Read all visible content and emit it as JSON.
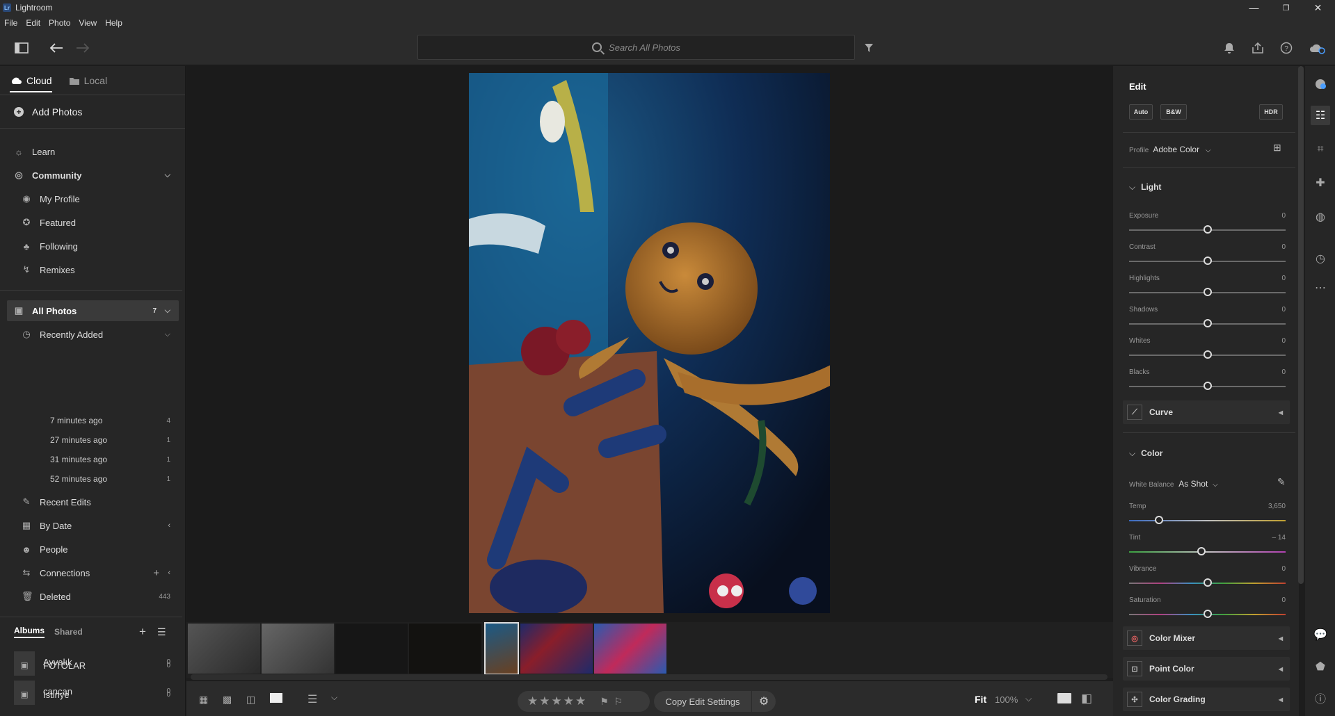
{
  "app": {
    "title": "Lightroom",
    "logo": "Lr"
  },
  "window": {
    "minimize": "—",
    "restore": "❐",
    "close": "✕"
  },
  "menu": [
    "File",
    "Edit",
    "Photo",
    "View",
    "Help"
  ],
  "search": {
    "placeholder": "Search All Photos"
  },
  "left": {
    "tabs": [
      "Cloud",
      "Local"
    ],
    "add_photos": "Add Photos",
    "learn": "Learn",
    "community": "Community",
    "community_items": [
      "My Profile",
      "Featured",
      "Following",
      "Remixes"
    ],
    "all_photos": {
      "label": "All Photos",
      "count": "7"
    },
    "recently_added": "Recently Added",
    "recent_groups": [
      {
        "label": "7 minutes ago",
        "count": "4"
      },
      {
        "label": "27 minutes ago",
        "count": "1"
      },
      {
        "label": "31 minutes ago",
        "count": "1"
      },
      {
        "label": "52 minutes ago",
        "count": "1"
      }
    ],
    "recent_edits": "Recent Edits",
    "by_date": "By Date",
    "people": "People",
    "connections": "Connections",
    "deleted": {
      "label": "Deleted",
      "count": "443"
    },
    "album_tabs": [
      "Albums",
      "Shared"
    ],
    "albums": [
      {
        "name": "Ayvalık",
        "count": "0"
      },
      {
        "name": "cancan",
        "count": "0"
      },
      {
        "name": "FOTOLAR",
        "count": "0"
      },
      {
        "name": "İstinye",
        "count": "0"
      }
    ]
  },
  "bottom": {
    "copy_edit": "Copy Edit Settings",
    "fit": "Fit",
    "zoom": "100%"
  },
  "edit": {
    "title": "Edit",
    "auto": "Auto",
    "bw": "B&W",
    "hdr": "HDR",
    "profile_label": "Profile",
    "profile_value": "Adobe Color",
    "light_title": "Light",
    "light": [
      {
        "label": "Exposure",
        "value": "0",
        "pos": 0.5
      },
      {
        "label": "Contrast",
        "value": "0",
        "pos": 0.5
      },
      {
        "label": "Highlights",
        "value": "0",
        "pos": 0.5
      },
      {
        "label": "Shadows",
        "value": "0",
        "pos": 0.5
      },
      {
        "label": "Whites",
        "value": "0",
        "pos": 0.5
      },
      {
        "label": "Blacks",
        "value": "0",
        "pos": 0.5
      }
    ],
    "curve": "Curve",
    "color_title": "Color",
    "wb_label": "White Balance",
    "wb_value": "As Shot",
    "color": [
      {
        "label": "Temp",
        "value": "3,650",
        "pos": 0.19
      },
      {
        "label": "Tint",
        "value": "– 14",
        "pos": 0.46
      },
      {
        "label": "Vibrance",
        "value": "0",
        "pos": 0.5
      },
      {
        "label": "Saturation",
        "value": "0",
        "pos": 0.5
      }
    ],
    "color_mixer": "Color Mixer",
    "point_color": "Point Color",
    "color_grading": "Color Grading"
  }
}
